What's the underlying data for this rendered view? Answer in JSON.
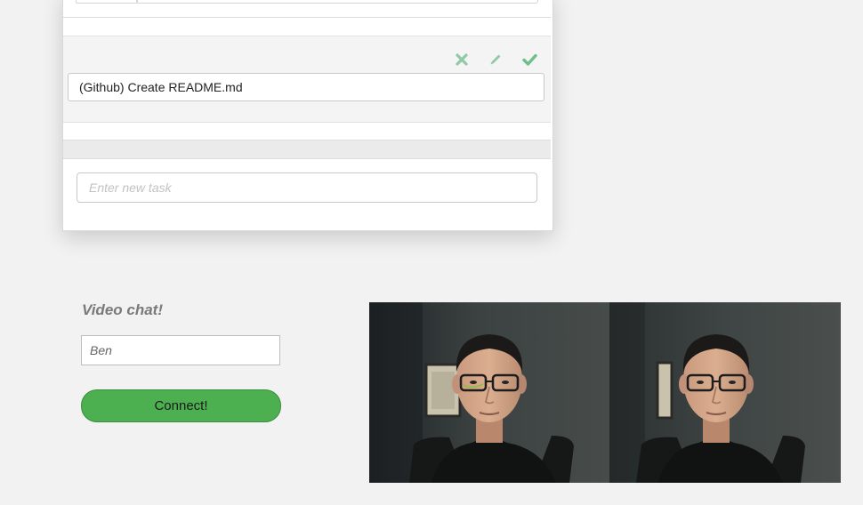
{
  "task_list": {
    "editing_task": {
      "value": "(Github) Create README.md",
      "actions": [
        {
          "name": "cancel-icon",
          "color": "#8fc9a6"
        },
        {
          "name": "pencil-icon",
          "color": "#8fc9a6"
        },
        {
          "name": "checkmark-icon",
          "color": "#6fbf8c"
        }
      ]
    },
    "new_task": {
      "placeholder": "Enter new task",
      "value": ""
    }
  },
  "video_chat": {
    "title": "Video chat!",
    "name_value": "Ben",
    "connect_label": "Connect!",
    "button_color": "#4caf50"
  }
}
